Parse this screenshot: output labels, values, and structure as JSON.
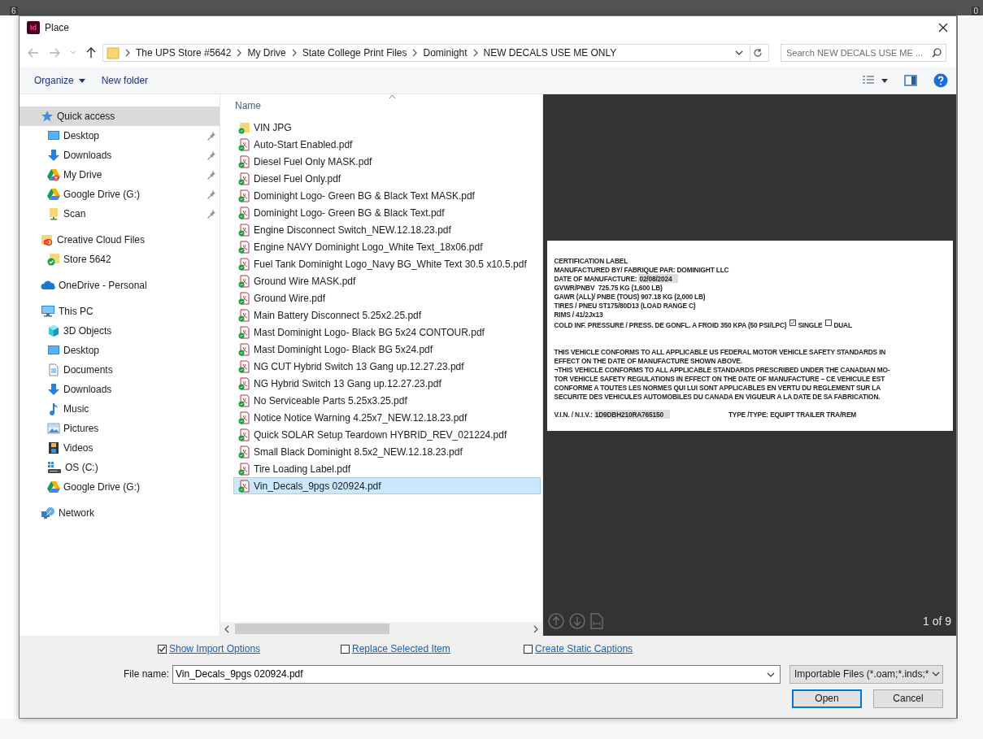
{
  "ruler": {
    "labels": [
      "6",
      "0"
    ]
  },
  "window": {
    "app_icon": "Id",
    "title": "Place"
  },
  "address_bar": {
    "segments": [
      "The UPS Store #5642",
      "My Drive",
      "State College Print Files",
      "Dominight",
      "NEW DECALS USE ME ONLY"
    ],
    "search_placeholder": "Search NEW DECALS USE ME ..."
  },
  "toolbar": {
    "buttons": [
      "Organize",
      "New folder"
    ]
  },
  "sidebar": {
    "items": [
      {
        "label": "Quick access",
        "kind": "star",
        "selected": true,
        "children": [
          {
            "label": "Desktop",
            "kind": "desktop",
            "pinned": true,
            "selected": false
          },
          {
            "label": "Downloads",
            "kind": "download",
            "pinned": true,
            "selected": false
          },
          {
            "label": "My Drive",
            "kind": "mydrive",
            "pinned": true,
            "selected": false
          },
          {
            "label": "Google Drive (G:)",
            "kind": "gdrive",
            "pinned": true,
            "selected": false
          },
          {
            "label": "Scan",
            "kind": "scan",
            "pinned": true,
            "selected": false
          }
        ]
      },
      {
        "label": "Creative Cloud Files",
        "kind": "cc",
        "selected": false,
        "children": [
          {
            "label": "Store 5642",
            "kind": "synced",
            "selected": false
          }
        ]
      },
      {
        "label": "OneDrive - Personal",
        "kind": "onedrive",
        "selected": false
      },
      {
        "label": "This PC",
        "kind": "pc",
        "selected": false,
        "children": [
          {
            "label": "3D Objects",
            "kind": "cube",
            "selected": false
          },
          {
            "label": "Desktop",
            "kind": "desktop",
            "selected": false
          },
          {
            "label": "Documents",
            "kind": "documents",
            "selected": false
          },
          {
            "label": "Downloads",
            "kind": "download",
            "selected": false
          },
          {
            "label": "Music",
            "kind": "music",
            "selected": false
          },
          {
            "label": "Pictures",
            "kind": "pictures",
            "selected": false
          },
          {
            "label": "Videos",
            "kind": "videos",
            "selected": false
          },
          {
            "label": "OS (C:)",
            "kind": "drive",
            "selected": false
          },
          {
            "label": "Google Drive (G:)",
            "kind": "gdrive",
            "selected": false
          }
        ]
      },
      {
        "label": "Network",
        "kind": "network",
        "selected": false
      }
    ]
  },
  "file_list": {
    "column": "Name",
    "files": [
      {
        "name": "VIN JPG",
        "kind": "folder",
        "selected": false
      },
      {
        "name": "Auto-Start Enabled.pdf",
        "kind": "pdf",
        "selected": false
      },
      {
        "name": "Diesel Fuel Only MASK.pdf",
        "kind": "pdf",
        "selected": false
      },
      {
        "name": "Diesel Fuel Only.pdf",
        "kind": "pdf",
        "selected": false
      },
      {
        "name": "Dominight Logo- Green BG & Black Text MASK.pdf",
        "kind": "pdf",
        "selected": false
      },
      {
        "name": "Dominight Logo- Green BG & Black Text.pdf",
        "kind": "pdf",
        "selected": false
      },
      {
        "name": "Engine Disconnect Switch_NEW.12.18.23.pdf",
        "kind": "pdf",
        "selected": false
      },
      {
        "name": "Engine NAVY Dominight Logo_White Text_18x06.pdf",
        "kind": "pdf",
        "selected": false
      },
      {
        "name": "Fuel Tank Dominight Logo_Navy BG_White Text 30.5 x10.5.pdf",
        "kind": "pdf",
        "selected": false
      },
      {
        "name": "Ground Wire MASK.pdf",
        "kind": "pdf",
        "selected": false
      },
      {
        "name": "Ground Wire.pdf",
        "kind": "pdf",
        "selected": false
      },
      {
        "name": "Main Battery Disconnect 5.25x2.25.pdf",
        "kind": "pdf",
        "selected": false
      },
      {
        "name": "Mast Dominight Logo- Black BG 5x24 CONTOUR.pdf",
        "kind": "pdf",
        "selected": false
      },
      {
        "name": "Mast Dominight Logo- Black BG 5x24.pdf",
        "kind": "pdf",
        "selected": false
      },
      {
        "name": "NG CUT Hybrid Switch 13 Gang up.12.27.23.pdf",
        "kind": "pdf",
        "selected": false
      },
      {
        "name": "NG Hybrid Switch 13 Gang up.12.27.23.pdf",
        "kind": "pdf",
        "selected": false
      },
      {
        "name": "No Serviceable Parts 5.25x3.25.pdf",
        "kind": "pdf",
        "selected": false
      },
      {
        "name": "Notice Notice Warning 4.25x7_NEW.12.18.23.pdf",
        "kind": "pdf",
        "selected": false
      },
      {
        "name": "Quick SOLAR Setup Teardown HYBRID_REV_021224.pdf",
        "kind": "pdf",
        "selected": false
      },
      {
        "name": "Small Black Dominight 8.5x2_NEW.12.18.23.pdf",
        "kind": "pdf",
        "selected": false
      },
      {
        "name": "Tire Loading Label.pdf",
        "kind": "pdf",
        "selected": false
      },
      {
        "name": "Vin_Decals_9pgs 020924.pdf",
        "kind": "pdf",
        "selected": true
      }
    ]
  },
  "preview": {
    "page_indicator": "1 of 9",
    "label": {
      "lines": [
        {
          "text": "CERTIFICATION LABEL"
        },
        {
          "text": "MANUFACTURED BY/ FABRIQUE PAR: DOMINIGHT LLC"
        },
        {
          "text": "DATE OF MANUFACTURE:",
          "value": "02/08/2024"
        },
        {
          "text": "GVWR/PNBV  725.75 KG (1,600 LB)"
        },
        {
          "text": "GAWR (ALL)/ PNBE (TOUS) 907.18 KG (2,000 LB)"
        },
        {
          "text": "TIRES / PNEU ST175/80D13 (LOAD RANGE C)"
        },
        {
          "text": "RIMS / 41/2Jx13"
        },
        {
          "text": "COLD INF. PRESSURE / PRESS. DE GONFL. A FROID 350 KPA (50 PSI/LPC)",
          "checks": [
            {
              "label": "SINGLE",
              "checked": true
            },
            {
              "label": "DUAL",
              "checked": false
            }
          ]
        }
      ],
      "paragraphs": [
        [
          "THIS VEHICLE CONFORMS TO ALL APPLICABLE US FEDERAL MOTOR VEHICLE SAFETY STANDARDS IN",
          "EFFECT ON THE DATE OF MANUFACTURE SHOWN ABOVE."
        ],
        [
          "¬THIS VEHICLE CONFORMS TO ALL APPLICABLE STANDARDS PRESCRIBED UNDER THE CANADIAN MO-",
          "TOR VEHICLE SAFETY REGULATIONS IN EFFECT ON THE DATE OF MANUFACTURE – CE VEHICULE EST",
          "CONFORME A TOUTES LES NORMES QUI LUI SONT APPLICABLES EN VERTU DU REGLEMENT SUR LA",
          "SECURITE DES VEHICULES AUTOMOBILES DU CANADA EN VIGUEUR A LA DATE DE SA FABRICATION."
        ]
      ],
      "vin_label": "V.I.N. / N.I.V.:",
      "vin": "1D9DBH210RA765150",
      "type": "TYPE /TYPE: EQUIPT TRAILER TRA/REM"
    }
  },
  "options": [
    {
      "label": "Show Import Options",
      "checked": true
    },
    {
      "label": "Replace Selected Item",
      "checked": false
    },
    {
      "label": "Create Static Captions",
      "checked": false
    }
  ],
  "file_name": {
    "label": "File name:",
    "value": "Vin_Decals_9pgs 020924.pdf"
  },
  "file_type": {
    "value": "Importable Files (*.oam;*.inds;*"
  },
  "buttons": [
    {
      "label": "Open",
      "default": true
    },
    {
      "label": "Cancel",
      "default": false
    }
  ]
}
